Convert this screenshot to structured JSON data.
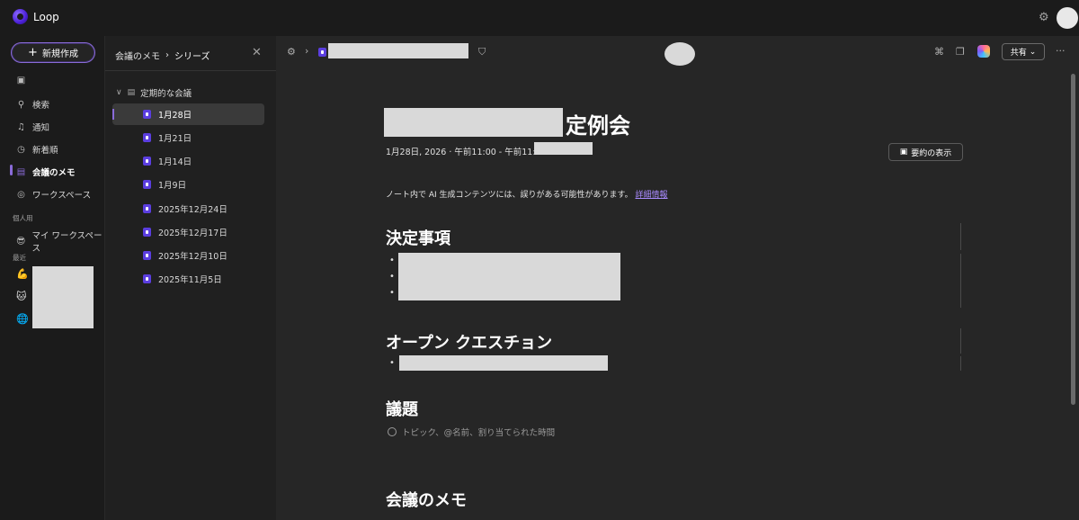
{
  "app": {
    "name": "Loop"
  },
  "nav": {
    "new_label": "新規作成",
    "items": [
      {
        "label": ""
      },
      {
        "label": "検索"
      },
      {
        "label": "通知"
      },
      {
        "label": "新着順"
      },
      {
        "label": "会議のメモ"
      },
      {
        "label": "ワークスペース"
      }
    ],
    "personal_section": "個人用",
    "my_workspace": "マイ ワークスペース",
    "recent_section": "最近"
  },
  "series": {
    "breadcrumb_root": "会議のメモ",
    "breadcrumb_current": "シリーズ",
    "folder": "定期的な会議",
    "pages": [
      "1月28日",
      "1月21日",
      "1月14日",
      "1月9日",
      "2025年12月24日",
      "2025年12月17日",
      "2025年12月10日",
      "2025年11月5日"
    ],
    "selected_index": 0
  },
  "toolbar": {
    "share_label": "共有",
    "more_label": "···"
  },
  "doc": {
    "title_suffix": "定例会",
    "meta": "1月28日, 2026 · 午前11:00 - 午前11:30 ·",
    "summary_button": "要約の表示",
    "disclaimer": "ノート内で AI 生成コンテンツには、誤りがある可能性があります。",
    "disclaimer_link": "詳細情報",
    "section_decisions": "決定事項",
    "section_questions": "オープン クエスチョン",
    "section_agenda": "議題",
    "agenda_placeholder": "トピック、@名前、割り当てられた時間",
    "section_notes": "会議のメモ"
  },
  "icons": {
    "search": "search-icon",
    "bell": "bell-icon",
    "clock": "clock-icon",
    "notes": "notes-icon",
    "workspace": "workspace-icon",
    "settings": "gear-icon"
  },
  "colors": {
    "accent": "#8a6bd8",
    "bg": "#1b1b1b",
    "main_bg": "#262626",
    "panel_bg": "#202020"
  }
}
